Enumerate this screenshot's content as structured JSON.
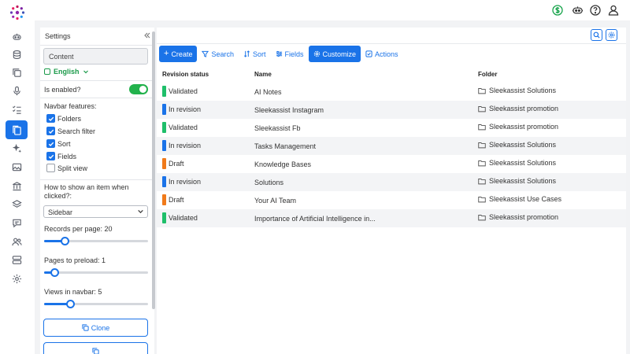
{
  "topbar": {
    "icons": [
      "dollar-icon",
      "robot-icon",
      "help-icon",
      "user-icon"
    ]
  },
  "rail": {
    "icons": [
      "logo",
      "bot-icon",
      "database-icon",
      "copy-icon",
      "microphone-icon",
      "checklist-icon",
      "documents-icon",
      "sparkle-icon",
      "image-icon",
      "bank-icon",
      "layers-icon",
      "chat-icon",
      "users-icon",
      "server-icon",
      "gear-icon"
    ],
    "active": "documents-icon",
    "accent": "#1a73e8"
  },
  "settings": {
    "title": "Settings",
    "content_value": "Content",
    "language": "English",
    "is_enabled_label": "Is enabled?",
    "is_enabled": true,
    "navbar_features_label": "Navbar features:",
    "features": [
      {
        "label": "Folders",
        "checked": true
      },
      {
        "label": "Search filter",
        "checked": true
      },
      {
        "label": "Sort",
        "checked": true
      },
      {
        "label": "Fields",
        "checked": true
      },
      {
        "label": "Split view",
        "checked": false
      }
    ],
    "how_to_show_label": "How to show an item when clicked?:",
    "how_to_show_value": "Sidebar",
    "records_per_page_label": "Records per page: 20",
    "records_per_page_level": 0.2,
    "pages_to_preload_label": "Pages to preload: 1",
    "pages_to_preload_level": 0.1,
    "views_in_navbar_label": "Views in navbar: 5",
    "views_in_navbar_level": 0.25,
    "clone_label": "Clone"
  },
  "toolbar": {
    "create": "Create",
    "search": "Search",
    "sort": "Sort",
    "fields": "Fields",
    "customize": "Customize",
    "actions": "Actions"
  },
  "table": {
    "columns": [
      "Revision status",
      "Name",
      "Folder"
    ],
    "status_colors": {
      "Validated": "#1fbf6a",
      "In revision": "#1a73e8",
      "Draft": "#f07a1a"
    },
    "rows": [
      {
        "status": "Validated",
        "name": "AI Notes",
        "folder": "Sleekassist Solutions"
      },
      {
        "status": "In revision",
        "name": "Sleekassist Instagram",
        "folder": "Sleekassist promotion"
      },
      {
        "status": "Validated",
        "name": "Sleekassist Fb",
        "folder": "Sleekassist promotion"
      },
      {
        "status": "In revision",
        "name": "Tasks Management",
        "folder": "Sleekassist Solutions"
      },
      {
        "status": "Draft",
        "name": "Knowledge Bases",
        "folder": "Sleekassist Solutions"
      },
      {
        "status": "In revision",
        "name": "Solutions",
        "folder": "Sleekassist Solutions"
      },
      {
        "status": "Draft",
        "name": "Your AI Team",
        "folder": "Sleekassist Use Cases"
      },
      {
        "status": "Validated",
        "name": "Importance of Artificial Intelligence in...",
        "folder": "Sleekassist promotion"
      }
    ]
  }
}
